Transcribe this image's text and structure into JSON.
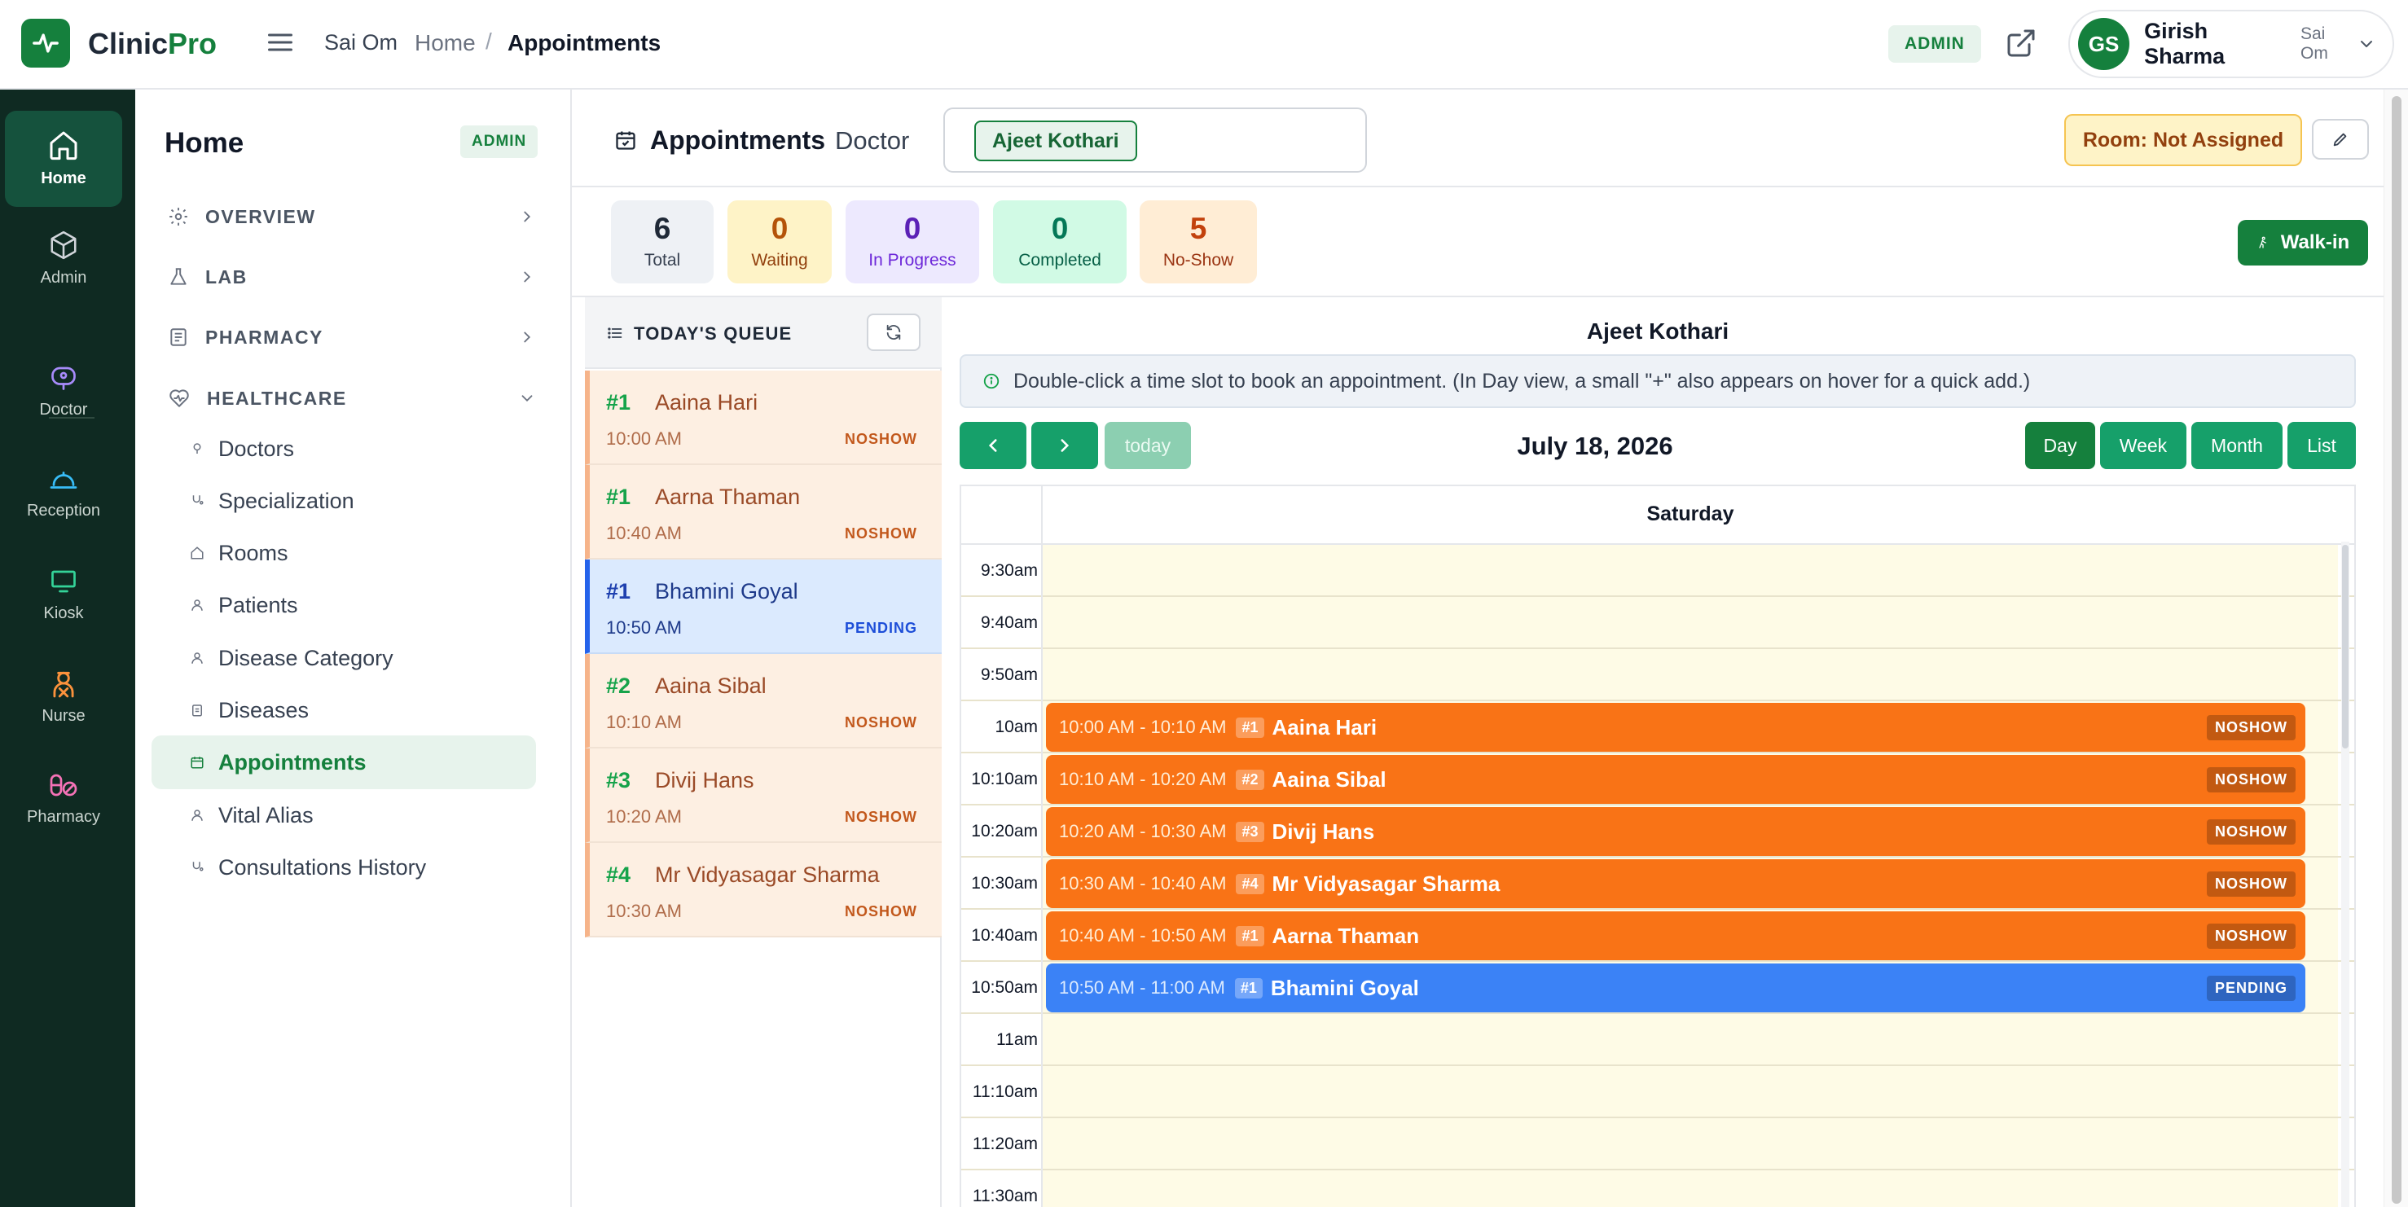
{
  "app": {
    "name_part1": "Clinic",
    "name_part2": "Pro",
    "brand_color": "#15803d"
  },
  "topbar": {
    "org": "Sai Om",
    "breadcrumb_home": "Home",
    "breadcrumb_sep": "/",
    "breadcrumb_current": "Appointments",
    "role_badge": "ADMIN",
    "user": {
      "initials": "GS",
      "name": "Girish Sharma",
      "org": "Sai Om"
    }
  },
  "rail": {
    "items": [
      {
        "label": "Home",
        "icon": "home-icon"
      },
      {
        "label": "Admin",
        "icon": "cube-icon"
      },
      {
        "label": "Doctor",
        "icon": "stethoscope-icon"
      },
      {
        "label": "Reception",
        "icon": "bell-icon"
      },
      {
        "label": "Kiosk",
        "icon": "monitor-icon"
      },
      {
        "label": "Nurse",
        "icon": "nurse-icon"
      },
      {
        "label": "Pharmacy",
        "icon": "pills-icon"
      }
    ]
  },
  "sidebar": {
    "title": "Home",
    "badge": "ADMIN",
    "sections": [
      {
        "label": "OVERVIEW",
        "icon": "gear-icon"
      },
      {
        "label": "LAB",
        "icon": "flask-icon"
      },
      {
        "label": "PHARMACY",
        "icon": "pharmacy-icon"
      },
      {
        "label": "HEALTHCARE",
        "icon": "heart-pulse-icon"
      }
    ],
    "links": [
      {
        "label": "Doctors"
      },
      {
        "label": "Specialization"
      },
      {
        "label": "Rooms"
      },
      {
        "label": "Patients"
      },
      {
        "label": "Disease Category"
      },
      {
        "label": "Diseases"
      },
      {
        "label": "Appointments"
      },
      {
        "label": "Vital Alias"
      },
      {
        "label": "Consultations History"
      }
    ]
  },
  "header": {
    "title": "Appointments",
    "doctor_label": "Doctor",
    "doctor_selected": "Ajeet Kothari",
    "room": "Room: Not Assigned"
  },
  "stats": [
    {
      "value": "6",
      "label": "Total"
    },
    {
      "value": "0",
      "label": "Waiting"
    },
    {
      "value": "0",
      "label": "In Progress"
    },
    {
      "value": "0",
      "label": "Completed"
    },
    {
      "value": "5",
      "label": "No-Show"
    }
  ],
  "walkin_label": "Walk-in",
  "queue": {
    "title": "TODAY'S QUEUE",
    "items": [
      {
        "num": "#1",
        "name": "Aaina Hari",
        "time": "10:00 AM",
        "status": "NOSHOW"
      },
      {
        "num": "#1",
        "name": "Aarna Thaman",
        "time": "10:40 AM",
        "status": "NOSHOW"
      },
      {
        "num": "#1",
        "name": "Bhamini Goyal",
        "time": "10:50 AM",
        "status": "PENDING"
      },
      {
        "num": "#2",
        "name": "Aaina Sibal",
        "time": "10:10 AM",
        "status": "NOSHOW"
      },
      {
        "num": "#3",
        "name": "Divij Hans",
        "time": "10:20 AM",
        "status": "NOSHOW"
      },
      {
        "num": "#4",
        "name": "Mr Vidyasagar Sharma",
        "time": "10:30 AM",
        "status": "NOSHOW"
      }
    ]
  },
  "calendar": {
    "doctor": "Ajeet Kothari",
    "hint": "Double-click a time slot to book an appointment. (In Day view, a small \"+\" also appears on hover for a quick add.)",
    "today_label": "today",
    "date": "July 18, 2026",
    "views": [
      "Day",
      "Week",
      "Month",
      "List"
    ],
    "active_view": "Day",
    "day_header": "Saturday",
    "slots": [
      "9:30am",
      "9:40am",
      "9:50am",
      "10am",
      "10:10am",
      "10:20am",
      "10:30am",
      "10:40am",
      "10:50am",
      "11am",
      "11:10am",
      "11:20am",
      "11:30am"
    ],
    "events": [
      {
        "time": "10:00 AM - 10:10 AM",
        "num": "#1",
        "name": "Aaina Hari",
        "status": "NOSHOW"
      },
      {
        "time": "10:10 AM - 10:20 AM",
        "num": "#2",
        "name": "Aaina Sibal",
        "status": "NOSHOW"
      },
      {
        "time": "10:20 AM - 10:30 AM",
        "num": "#3",
        "name": "Divij Hans",
        "status": "NOSHOW"
      },
      {
        "time": "10:30 AM - 10:40 AM",
        "num": "#4",
        "name": "Mr Vidyasagar Sharma",
        "status": "NOSHOW"
      },
      {
        "time": "10:40 AM - 10:50 AM",
        "num": "#1",
        "name": "Aarna Thaman",
        "status": "NOSHOW"
      },
      {
        "time": "10:50 AM - 11:00 AM",
        "num": "#1",
        "name": "Bhamini Goyal",
        "status": "PENDING"
      }
    ]
  }
}
